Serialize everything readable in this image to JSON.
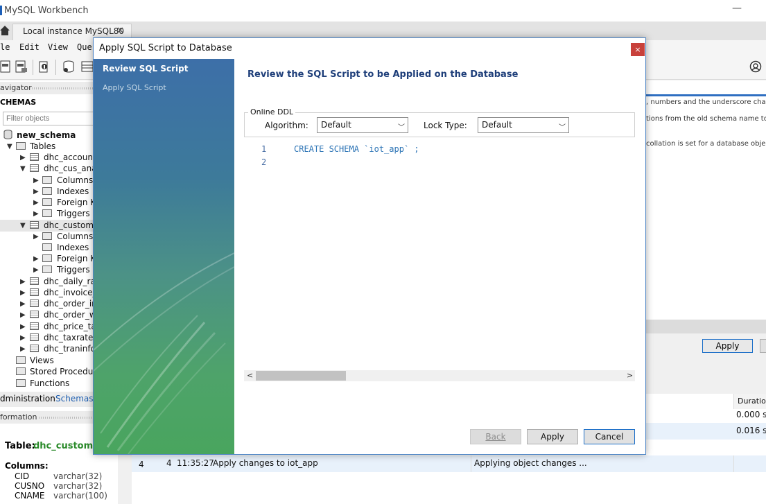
{
  "window": {
    "title": "MySQL Workbench",
    "minimize_glyph": "—"
  },
  "tab": {
    "label": "Local instance MySQL80",
    "close_glyph": "✕"
  },
  "menu": {
    "items": [
      "le",
      "Edit",
      "View",
      "Quer"
    ]
  },
  "sidebar": {
    "navigator_label": "avigator",
    "schemas_label": "CHEMAS",
    "filter_placeholder": "Filter objects",
    "tree": {
      "schema": "new_schema",
      "tables": "Tables",
      "t1": "dhc_account",
      "t2": "dhc_cus_analy",
      "t2_columns": "Columns",
      "t2_indexes": "Indexes",
      "t2_fk": "Foreign Ke",
      "t2_triggers": "Triggers",
      "t3": "dhc_customer",
      "t3_columns": "Columns",
      "t3_indexes": "Indexes",
      "t3_fk": "Foreign Ke",
      "t3_triggers": "Triggers",
      "t4": "dhc_daily_rate",
      "t5": "dhc_invoice_w",
      "t6": "dhc_order_inf",
      "t7": "dhc_order_wa",
      "t8": "dhc_price_tax",
      "t9": "dhc_taxrate",
      "t10": "dhc_traninfo",
      "views": "Views",
      "procs": "Stored Procedures",
      "funcs": "Functions"
    },
    "tab_admin": "dministration",
    "tab_schemas": "Schemas",
    "info_label": "formation",
    "info": {
      "table_prefix": "Table:",
      "table_name": "dhc_customer",
      "columns_label": "Columns:",
      "cols": [
        {
          "name": "CID",
          "type": "varchar(32)"
        },
        {
          "name": "CUSNO",
          "type": "varchar(32)"
        },
        {
          "name": "CNAME",
          "type": "varchar(100)"
        }
      ]
    }
  },
  "right_panel": {
    "line1": ", numbers and the underscore charact",
    "line2": "tions from the old schema name to the ne",
    "line3": "collation is set for a database object (it",
    "apply_label": "Apply"
  },
  "output": {
    "duration_header": "Duration",
    "durations": [
      "0.000 sec",
      "0.016 sec"
    ],
    "row": {
      "index": "4",
      "num": "4",
      "time": "11:35:27",
      "action": "Apply changes to iot_app",
      "message": "Applying object changes ..."
    }
  },
  "dialog": {
    "title": "Apply SQL Script to Database",
    "close_glyph": "×",
    "steps": [
      "Review SQL Script",
      "Apply SQL Script"
    ],
    "heading": "Review the SQL Script to be Applied on the Database",
    "online_ddl": {
      "legend": "Online DDL",
      "algorithm_label": "Algorithm:",
      "algorithm_value": "Default",
      "lock_label": "Lock Type:",
      "lock_value": "Default"
    },
    "editor": {
      "lines": [
        {
          "num": "1",
          "code": "CREATE SCHEMA `iot_app` ;"
        },
        {
          "num": "2",
          "code": ""
        }
      ]
    },
    "buttons": {
      "back": "Back",
      "apply": "Apply",
      "cancel": "Cancel"
    }
  }
}
